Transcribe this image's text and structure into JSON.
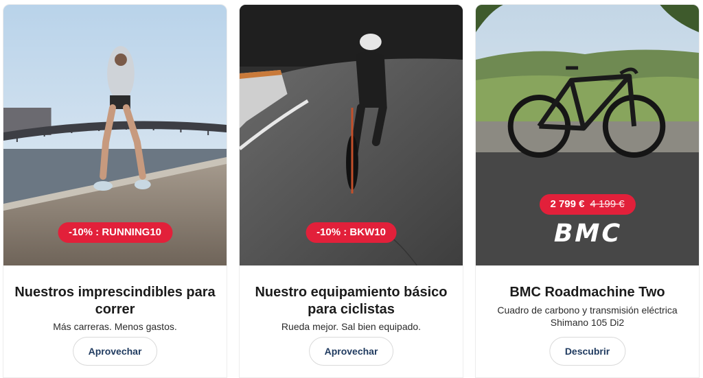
{
  "cards": [
    {
      "badge": "-10% : RUNNING10",
      "title": "Nuestros imprescindibles para correr",
      "subtitle": "Más carreras. Menos gastos.",
      "cta": "Aprovechar"
    },
    {
      "badge": "-10% : BKW10",
      "title": "Nuestro equipamiento básico para ciclistas",
      "subtitle": "Rueda mejor. Sal bien equipado.",
      "cta": "Aprovechar"
    },
    {
      "price": "2 799 €",
      "old_price": "4 199 €",
      "brand": "BMC",
      "title": "BMC Roadmachine Two",
      "subtitle": "Cuadro de carbono y transmisión eléctrica Shimano 105 Di2",
      "cta": "Descubrir"
    }
  ],
  "colors": {
    "badge_red": "#e2203a",
    "cta_text": "#1f3a5f",
    "border": "#d9d9d9"
  }
}
